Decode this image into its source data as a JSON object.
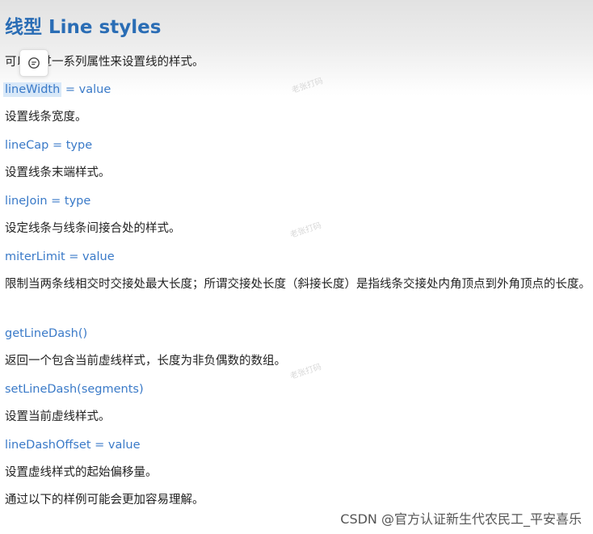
{
  "title": "线型 Line styles",
  "intro": "可以通过一系列属性来设置线的样式。",
  "items": [
    {
      "code_hl": "lineWidth",
      "code_rest": " = value",
      "desc": "设置线条宽度。"
    },
    {
      "code": "lineCap = type",
      "desc": "设置线条末端样式。"
    },
    {
      "code": "lineJoin = type",
      "desc": "设定线条与线条间接合处的样式。"
    },
    {
      "code": "miterLimit = value",
      "desc": "限制当两条线相交时交接处最大长度；所谓交接处长度（斜接长度）是指线条交接处内角顶点到外角顶点的长度。"
    },
    {
      "code": "getLineDash()",
      "desc": "返回一个包含当前虚线样式，长度为非负偶数的数组。"
    },
    {
      "code": "setLineDash(segments)",
      "desc": "设置当前虚线样式。"
    },
    {
      "code": "lineDashOffset = value",
      "desc": "设置虚线样式的起始偏移量。"
    }
  ],
  "outro": "通过以下的样例可能会更加容易理解。",
  "comment_icon": "comment-icon",
  "watermark": "老张打码",
  "footer": "CSDN @官方认证新生代农民工_平安喜乐"
}
